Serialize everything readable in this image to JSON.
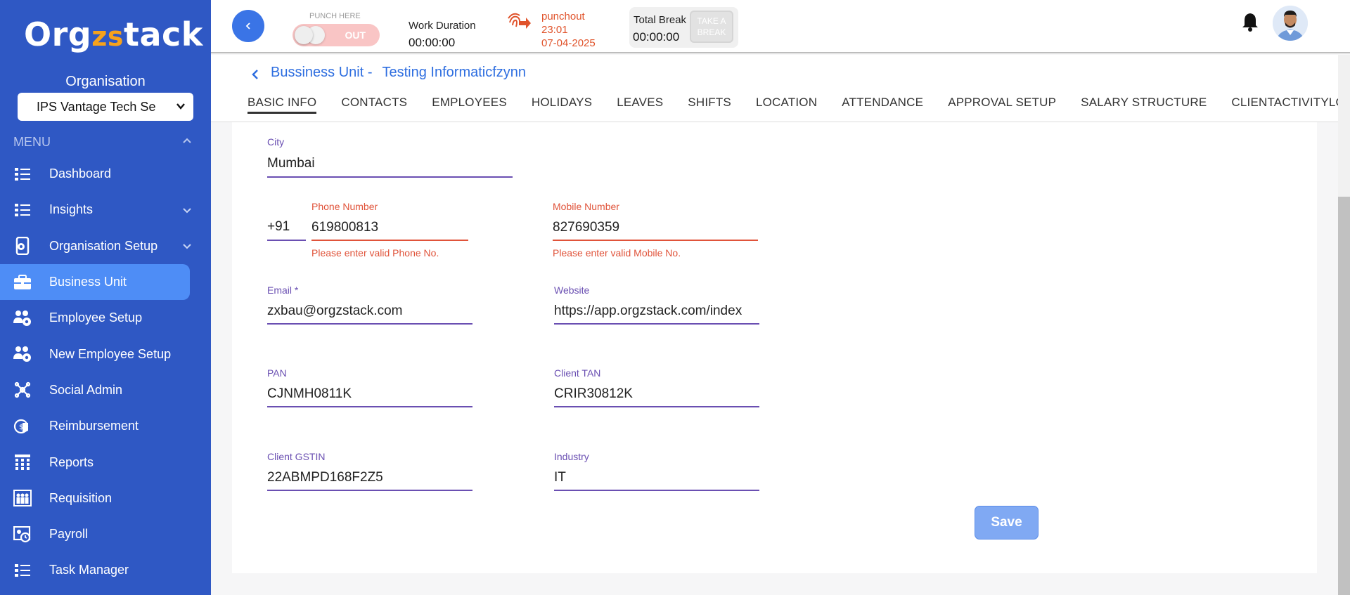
{
  "sidebar": {
    "logo_pre": "Org",
    "logo_mid": "zs",
    "logo_post": "tack",
    "org_label": "Organisation",
    "org_selected": "IPS Vantage Tech Se",
    "menu_label": "MENU",
    "items": [
      {
        "label": "Dashboard",
        "icon": "dashboard-icon",
        "chevron": false
      },
      {
        "label": "Insights",
        "icon": "insights-icon",
        "chevron": true
      },
      {
        "label": "Organisation Setup",
        "icon": "organisation-setup-icon",
        "chevron": true
      },
      {
        "label": "Business Unit",
        "icon": "briefcase-icon",
        "chevron": false,
        "active": true
      },
      {
        "label": "Employee Setup",
        "icon": "employee-setup-icon",
        "chevron": false
      },
      {
        "label": "New Employee Setup",
        "icon": "new-employee-setup-icon",
        "chevron": false
      },
      {
        "label": "Social Admin",
        "icon": "social-admin-icon",
        "chevron": false
      },
      {
        "label": "Reimbursement",
        "icon": "reimbursement-icon",
        "chevron": false
      },
      {
        "label": "Reports",
        "icon": "reports-icon",
        "chevron": false
      },
      {
        "label": "Requisition",
        "icon": "requisition-icon",
        "chevron": false
      },
      {
        "label": "Payroll",
        "icon": "payroll-icon",
        "chevron": false
      },
      {
        "label": "Task Manager",
        "icon": "task-manager-icon",
        "chevron": false
      }
    ]
  },
  "topbar": {
    "punch_here": "PUNCH HERE",
    "toggle_state": "OUT",
    "work_duration_label": "Work Duration",
    "work_duration_value": "00:00:00",
    "punchout_label": "punchout",
    "punchout_time": "23:01",
    "punchout_date": "07-04-2025",
    "total_break_label": "Total Break",
    "total_break_value": "00:00:00",
    "take_break_line1": "TAKE A",
    "take_break_line2": "BREAK"
  },
  "breadcrumb": {
    "section": "Bussiness Unit -",
    "name": "Testing Informaticfzynn"
  },
  "tabs": [
    "BASIC INFO",
    "CONTACTS",
    "EMPLOYEES",
    "HOLIDAYS",
    "LEAVES",
    "SHIFTS",
    "LOCATION",
    "ATTENDANCE",
    "APPROVAL SETUP",
    "SALARY STRUCTURE",
    "CLIENTACTIVITYLOG"
  ],
  "form": {
    "city": {
      "label": "City",
      "value": "Mumbai"
    },
    "country_code": "+91",
    "phone": {
      "label": "Phone Number",
      "value": "619800813",
      "error": "Please enter valid Phone No."
    },
    "mobile": {
      "label": "Mobile Number",
      "value": "827690359",
      "error": "Please enter valid Mobile No."
    },
    "email": {
      "label": "Email *",
      "value": "zxbau@orgzstack.com"
    },
    "website": {
      "label": "Website",
      "value": "https://app.orgzstack.com/index"
    },
    "pan": {
      "label": "PAN",
      "value": "CJNMH0811K"
    },
    "tan": {
      "label": "Client TAN",
      "value": "CRIR30812K"
    },
    "gstin": {
      "label": "Client GSTIN",
      "value": "22ABMPD168F2Z5"
    },
    "industry": {
      "label": "Industry",
      "value": "IT"
    },
    "save_label": "Save"
  },
  "colors": {
    "sidebar": "#2f58c4",
    "active_item": "#4e8df6",
    "accent": "#2e6ee0",
    "field_line": "#6a4fb2",
    "error": "#e0533a",
    "logo_accent": "#f7a21b"
  }
}
